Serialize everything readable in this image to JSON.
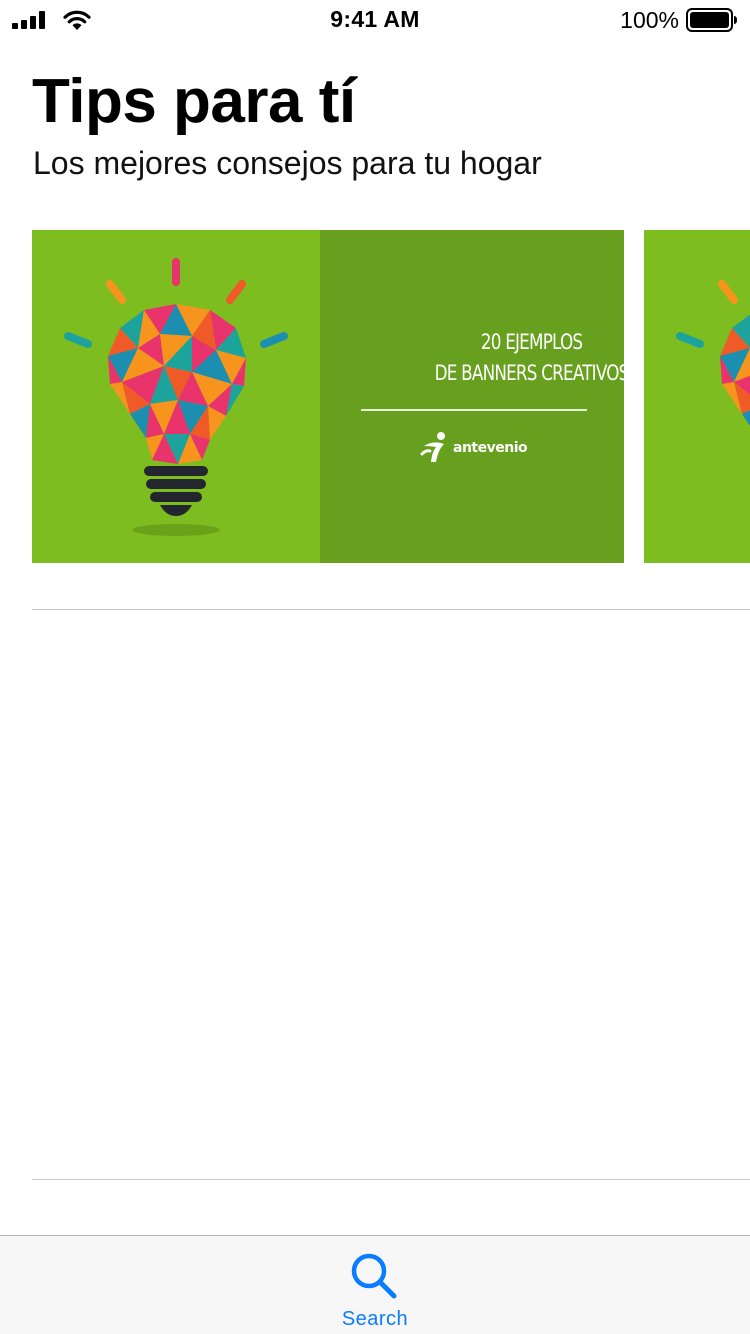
{
  "status_bar": {
    "time": "9:41 AM",
    "battery_percent": "100%",
    "icons": [
      "signal-icon",
      "wifi-icon",
      "battery-icon"
    ]
  },
  "header": {
    "title": "Tips para tí",
    "subtitle": "Los mejores consejos para tu hogar"
  },
  "carousel": {
    "cards": [
      {
        "line1": "20 EJEMPLOS",
        "line2": "DE BANNERS CREATIVOS",
        "brand": "antevenio",
        "illustration": "lightbulb-illustration"
      }
    ]
  },
  "tab_bar": {
    "items": [
      {
        "label": "Search",
        "icon": "search-icon",
        "selected": true
      }
    ]
  },
  "colors": {
    "accent": "#0a7cff",
    "banner_light_green": "#7dbd1f",
    "banner_dark_green": "#66a01e",
    "separator": "#c8c7cc",
    "tab_bar_bg": "#f7f7f7"
  }
}
